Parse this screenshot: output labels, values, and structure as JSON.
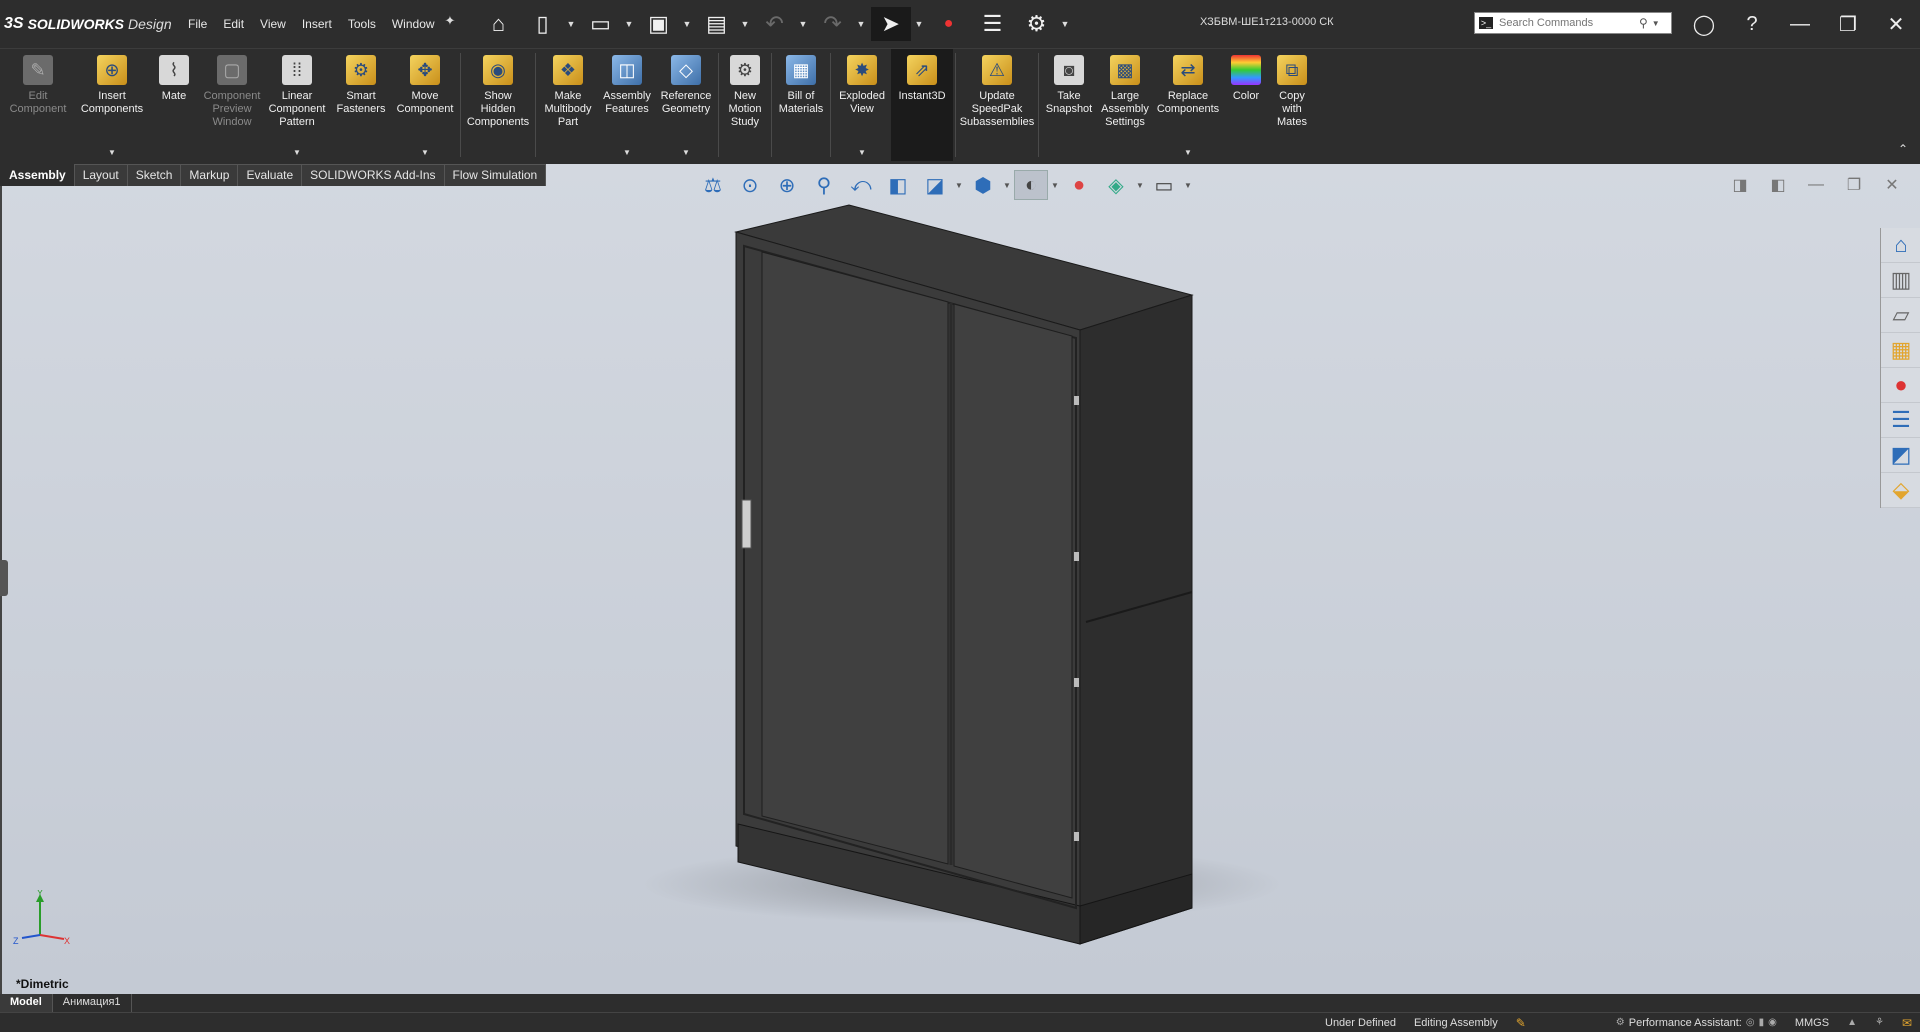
{
  "app": {
    "logo_ds": "3S",
    "logo_brand": "SOLIDWORKS",
    "logo_edition": "Design",
    "doc_title": "ХЗБВМ-ШЕ1т213-0000 СК"
  },
  "menu": [
    "File",
    "Edit",
    "View",
    "Insert",
    "Tools",
    "Window"
  ],
  "search": {
    "placeholder": "Search Commands"
  },
  "ribbon": [
    {
      "label": "Edit\nComponent",
      "disabled": true
    },
    {
      "label": "Insert\nComponents",
      "disabled": false,
      "dropdown": true
    },
    {
      "label": "Mate",
      "disabled": false
    },
    {
      "label": "Component\nPreview\nWindow",
      "disabled": true
    },
    {
      "label": "Linear\nComponent\nPattern",
      "disabled": false,
      "dropdown": true
    },
    {
      "label": "Smart\nFasteners",
      "disabled": false
    },
    {
      "label": "Move\nComponent",
      "disabled": false,
      "dropdown": true
    },
    {
      "label": "Show\nHidden\nComponents",
      "disabled": false
    },
    {
      "label": "Make\nMultibody\nPart",
      "disabled": false
    },
    {
      "label": "Assembly\nFeatures",
      "disabled": false,
      "dropdown": true
    },
    {
      "label": "Reference\nGeometry",
      "disabled": false,
      "dropdown": true
    },
    {
      "label": "New\nMotion\nStudy",
      "disabled": false
    },
    {
      "label": "Bill of\nMaterials",
      "disabled": false
    },
    {
      "label": "Exploded\nView",
      "disabled": false,
      "dropdown": true
    },
    {
      "label": "Instant3D",
      "disabled": false,
      "pressed": true
    },
    {
      "label": "Update\nSpeedPak\nSubassemblies",
      "disabled": false
    },
    {
      "label": "Take\nSnapshot",
      "disabled": false
    },
    {
      "label": "Large\nAssembly\nSettings",
      "disabled": false
    },
    {
      "label": "Replace\nComponents",
      "disabled": false
    },
    {
      "label": "Color",
      "disabled": false
    },
    {
      "label": "Copy\nwith\nMates",
      "disabled": false
    }
  ],
  "tabs": [
    "Assembly",
    "Layout",
    "Sketch",
    "Markup",
    "Evaluate",
    "SOLIDWORKS Add-Ins",
    "Flow Simulation"
  ],
  "triad": {
    "x": "X",
    "y": "Y",
    "z": "Z"
  },
  "view_name": "*Dimetric",
  "model_tabs": [
    "Model",
    "Анимация1"
  ],
  "status": {
    "state": "Under Defined",
    "mode": "Editing Assembly",
    "performance": "Performance Assistant:",
    "units": "MMGS"
  }
}
